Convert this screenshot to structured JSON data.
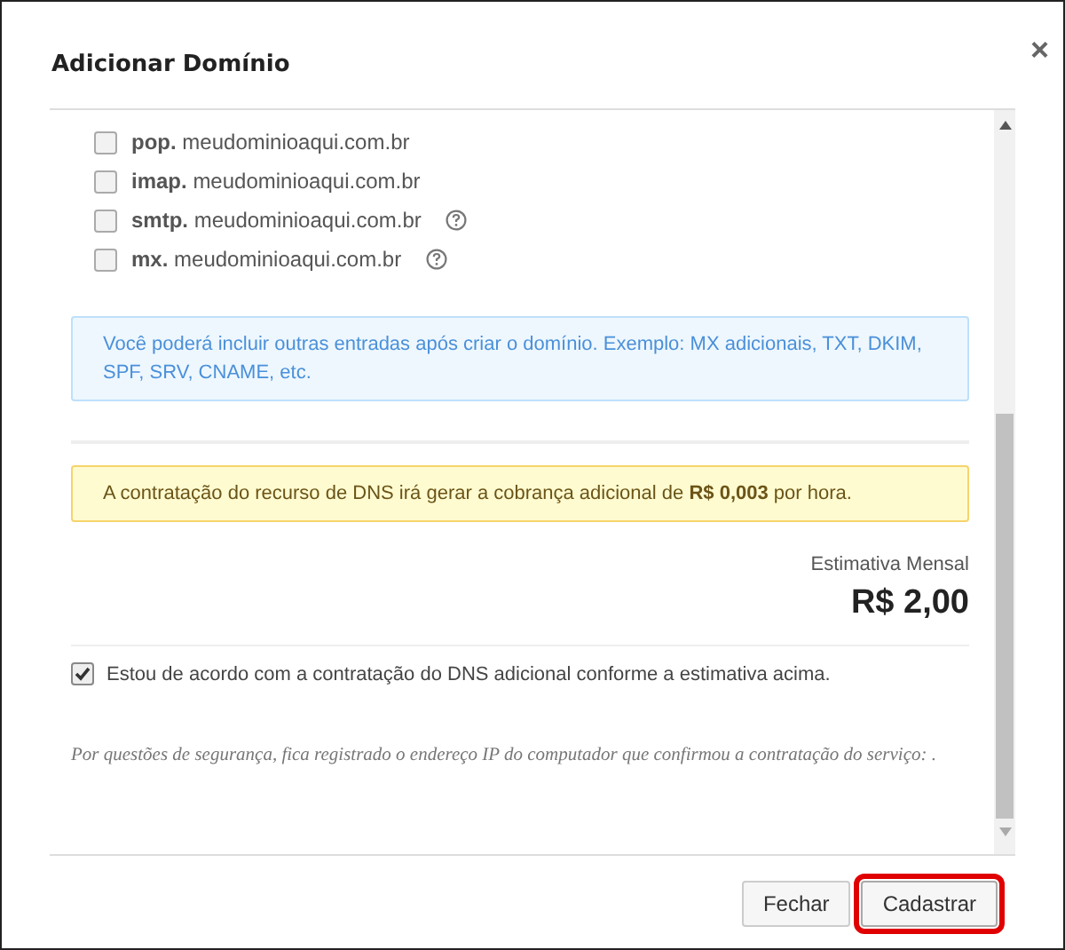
{
  "dialog": {
    "title": "Adicionar Domínio",
    "close": "×"
  },
  "entries": [
    {
      "prefix": "pop.",
      "domain": "meudominioaqui.com.br",
      "checked": false,
      "help": false
    },
    {
      "prefix": "imap.",
      "domain": "meudominioaqui.com.br",
      "checked": false,
      "help": false
    },
    {
      "prefix": "smtp.",
      "domain": "meudominioaqui.com.br",
      "checked": false,
      "help": true
    },
    {
      "prefix": "mx.",
      "domain": "meudominioaqui.com.br",
      "checked": false,
      "help": true
    }
  ],
  "info_note": "Você poderá incluir outras entradas após criar o domínio. Exemplo: MX adicionais, TXT, DKIM, SPF, SRV, CNAME, etc.",
  "warning_note": "A contratação do recurso de DNS irá gerar a cobrança adicional de **R$ 0,003** por hora.",
  "estimate": {
    "label": "Estimativa Mensal",
    "value": "R$ 2,00"
  },
  "agreement": {
    "label": "Estou de acordo com a contratação do DNS adicional conforme a estimativa acima.",
    "checked": true
  },
  "security_note": "Por questões de segurança, fica registrado o endereço IP do computador que confirmou a contratação do serviço: .",
  "buttons": [
    {
      "label": "Fechar",
      "highlighted": false
    },
    {
      "label": "Cadastrar",
      "highlighted": true
    }
  ]
}
